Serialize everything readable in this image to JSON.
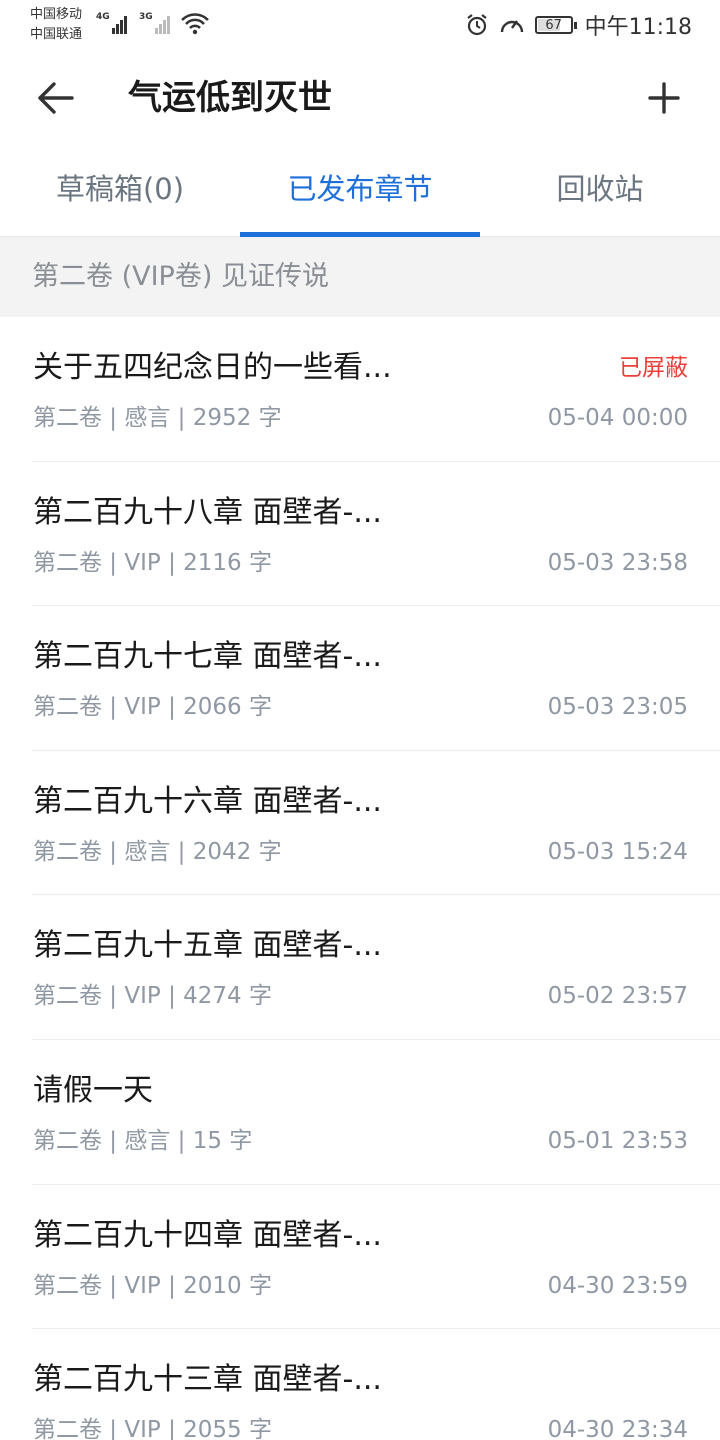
{
  "status_bar": {
    "carrier1": "中国移动",
    "carrier2": "中国联通",
    "net1": "4G",
    "net2": "3G",
    "battery": "67",
    "time": "中午11:18"
  },
  "header": {
    "title": "气运低到灭世",
    "back_icon": "back-arrow-icon",
    "add_icon": "plus-icon"
  },
  "tabs": [
    {
      "label": "草稿箱(0)",
      "active": false
    },
    {
      "label": "已发布章节",
      "active": true
    },
    {
      "label": "回收站",
      "active": false
    }
  ],
  "volume": {
    "label": "第二卷 (VIP卷) 见证传说"
  },
  "chapters": [
    {
      "title": "关于五四纪念日的一些看...",
      "status": "已屏蔽",
      "meta": "第二卷 | 感言 | 2952 字",
      "time": "05-04 00:00"
    },
    {
      "title": "第二百九十八章 面壁者-...",
      "status": "",
      "meta": "第二卷 | VIP | 2116 字",
      "time": "05-03 23:58"
    },
    {
      "title": "第二百九十七章 面壁者-...",
      "status": "",
      "meta": "第二卷 | VIP | 2066 字",
      "time": "05-03 23:05"
    },
    {
      "title": "第二百九十六章 面壁者-...",
      "status": "",
      "meta": "第二卷 | 感言 | 2042 字",
      "time": "05-03 15:24"
    },
    {
      "title": "第二百九十五章 面壁者-...",
      "status": "",
      "meta": "第二卷 | VIP | 4274 字",
      "time": "05-02 23:57"
    },
    {
      "title": "请假一天",
      "status": "",
      "meta": "第二卷 | 感言 | 15 字",
      "time": "05-01 23:53"
    },
    {
      "title": "第二百九十四章 面壁者-...",
      "status": "",
      "meta": "第二卷 | VIP | 2010 字",
      "time": "04-30 23:59"
    },
    {
      "title": "第二百九十三章 面壁者-...",
      "status": "",
      "meta": "第二卷 | VIP | 2055 字",
      "time": "04-30 23:34"
    }
  ],
  "colors": {
    "accent": "#1e6fd9",
    "blocked": "#e8423b",
    "muted": "#8f98a3"
  }
}
